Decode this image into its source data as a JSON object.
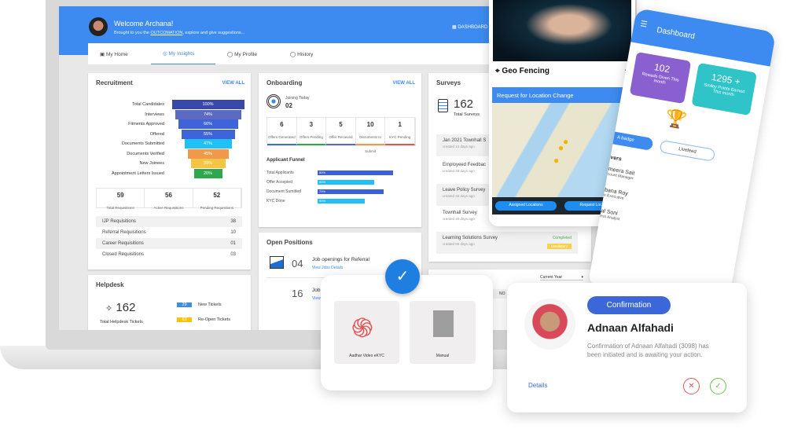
{
  "header": {
    "welcome": "Welcome Archana!",
    "subtitle_pre": "Brought to you the ",
    "subtitle_link": "OUTCOMATION",
    "subtitle_post": ", explore and give suggestions...",
    "dashboard": "DASHBOARD"
  },
  "tabs": [
    {
      "label": "My Home"
    },
    {
      "label": "My Insights",
      "active": true
    },
    {
      "label": "My Profile"
    },
    {
      "label": "History"
    }
  ],
  "recruitment": {
    "title": "Recruitment",
    "view_all": "VIEW ALL",
    "funnel": [
      {
        "label": "Total Candidates",
        "value": "100%",
        "color": "#3949ab"
      },
      {
        "label": "Interviews",
        "value": "74%",
        "color": "#5c6bc0"
      },
      {
        "label": "Fitments Approved",
        "value": "66%",
        "color": "#3f63d8"
      },
      {
        "label": "Offered",
        "value": "55%",
        "color": "#3f63d8"
      },
      {
        "label": "Documents Submitted",
        "value": "47%",
        "color": "#1ec0f5"
      },
      {
        "label": "Documents Verified",
        "value": "45%",
        "color": "#f0994a"
      },
      {
        "label": "New Joinees",
        "value": "39%",
        "color": "#f4c542"
      },
      {
        "label": "Appointment Letters Issued",
        "value": "20%",
        "color": "#2ea84a"
      }
    ],
    "stats": [
      {
        "value": "59",
        "label": "Total Requisitions"
      },
      {
        "value": "56",
        "label": "Active Requisitions"
      },
      {
        "value": "52",
        "label": "Pending Requisitions"
      }
    ],
    "rows": [
      {
        "label": "IJP Requisitions",
        "value": "38"
      },
      {
        "label": "Referral Requisitions",
        "value": "10"
      },
      {
        "label": "Career Requisitions",
        "value": "01"
      },
      {
        "label": "Closed Requisitions",
        "value": "03"
      }
    ]
  },
  "helpdesk": {
    "title": "Helpdesk",
    "total": "162",
    "total_label": "Total Helpdesk Tickets",
    "new": "29",
    "new_label": "New Tickets",
    "reopen": "63",
    "reopen_label": "Re-Open Tickets"
  },
  "onboarding": {
    "title": "Onboarding",
    "view_all": "VIEW ALL",
    "joining_label": "Joining Today",
    "joining": "02",
    "stats": [
      {
        "value": "6",
        "label": "Offers Generated",
        "color": "#3d6fd8"
      },
      {
        "value": "3",
        "label": "Offers Pending",
        "color": "#2ea84a"
      },
      {
        "value": "5",
        "label": "Offer Recieved",
        "color": "#5c6bc0"
      },
      {
        "value": "10",
        "label": "Documents to Submit",
        "color": "#f0994a"
      },
      {
        "value": "1",
        "label": "KYC Pending",
        "color": "#e05555"
      }
    ],
    "funnel_title": "Applicant Funnel",
    "funnel": [
      {
        "label": "Total Applicants",
        "value": "80%",
        "pct": 80,
        "color": "#3d5fd8"
      },
      {
        "label": "Offer Accepted",
        "value": "60%",
        "pct": 60,
        "color": "#1ec0f5"
      },
      {
        "label": "Document Sumitted",
        "value": "70%",
        "pct": 70,
        "color": "#3d5fd8"
      },
      {
        "label": "KYC Done",
        "value": "50%",
        "pct": 50,
        "color": "#1ec0f5"
      }
    ]
  },
  "positions": {
    "title": "Open Positions",
    "items": [
      {
        "count": "04",
        "label": "Job openings for Referral",
        "link": "View Jobs Details"
      },
      {
        "count": "16",
        "label": "Job",
        "link": "View"
      }
    ]
  },
  "surveys": {
    "title": "Surveys",
    "total": "162",
    "total_label": "Total Surveys",
    "items": [
      {
        "name": "Jan 2021 Townhall S",
        "age": "created 12 days ago"
      },
      {
        "name": "Employeed Feedbac",
        "age": "created 28 days ago"
      },
      {
        "name": "Leave Policy Survey",
        "age": "created 34 days ago"
      },
      {
        "name": "Townhall Survey",
        "age": "created 40 days ago"
      },
      {
        "name": "Learning Solutions Survey",
        "age": "created 66 days ago",
        "status": "Completed",
        "tag": "Mandatory"
      }
    ]
  },
  "bottom_card": {
    "dropdown": "Current Year",
    "col": "NO"
  },
  "geo": {
    "title": "Geo Fencing",
    "bar": "Request for Location Change",
    "btn1": "Assigned Locations",
    "btn2": "Request Location"
  },
  "mobile": {
    "title": "Dashboard",
    "rewards": "102",
    "rewards_label": "Rewads Given This month",
    "points": "1295 +",
    "points_label": "Smiley Points Earned  This month",
    "badge_btn": "A badge",
    "livefeed": "Livefeed",
    "section": "vers",
    "people": [
      {
        "name": "meera Sait",
        "role": "count Manager"
      },
      {
        "name": "bana Roy",
        "role": "e Executive"
      },
      {
        "name": "al Soni",
        "role": "ess Analyst"
      }
    ]
  },
  "ekyc": {
    "opt1": "Aadhar Video eKYC",
    "opt2": "Manual"
  },
  "confirm": {
    "badge": "Confirmation",
    "name": "Adnaan Alfahadi",
    "message": "Confirmation of Adnaan Alfahadi (3098) has been initiated and is awaiting your action.",
    "details": "Details"
  }
}
